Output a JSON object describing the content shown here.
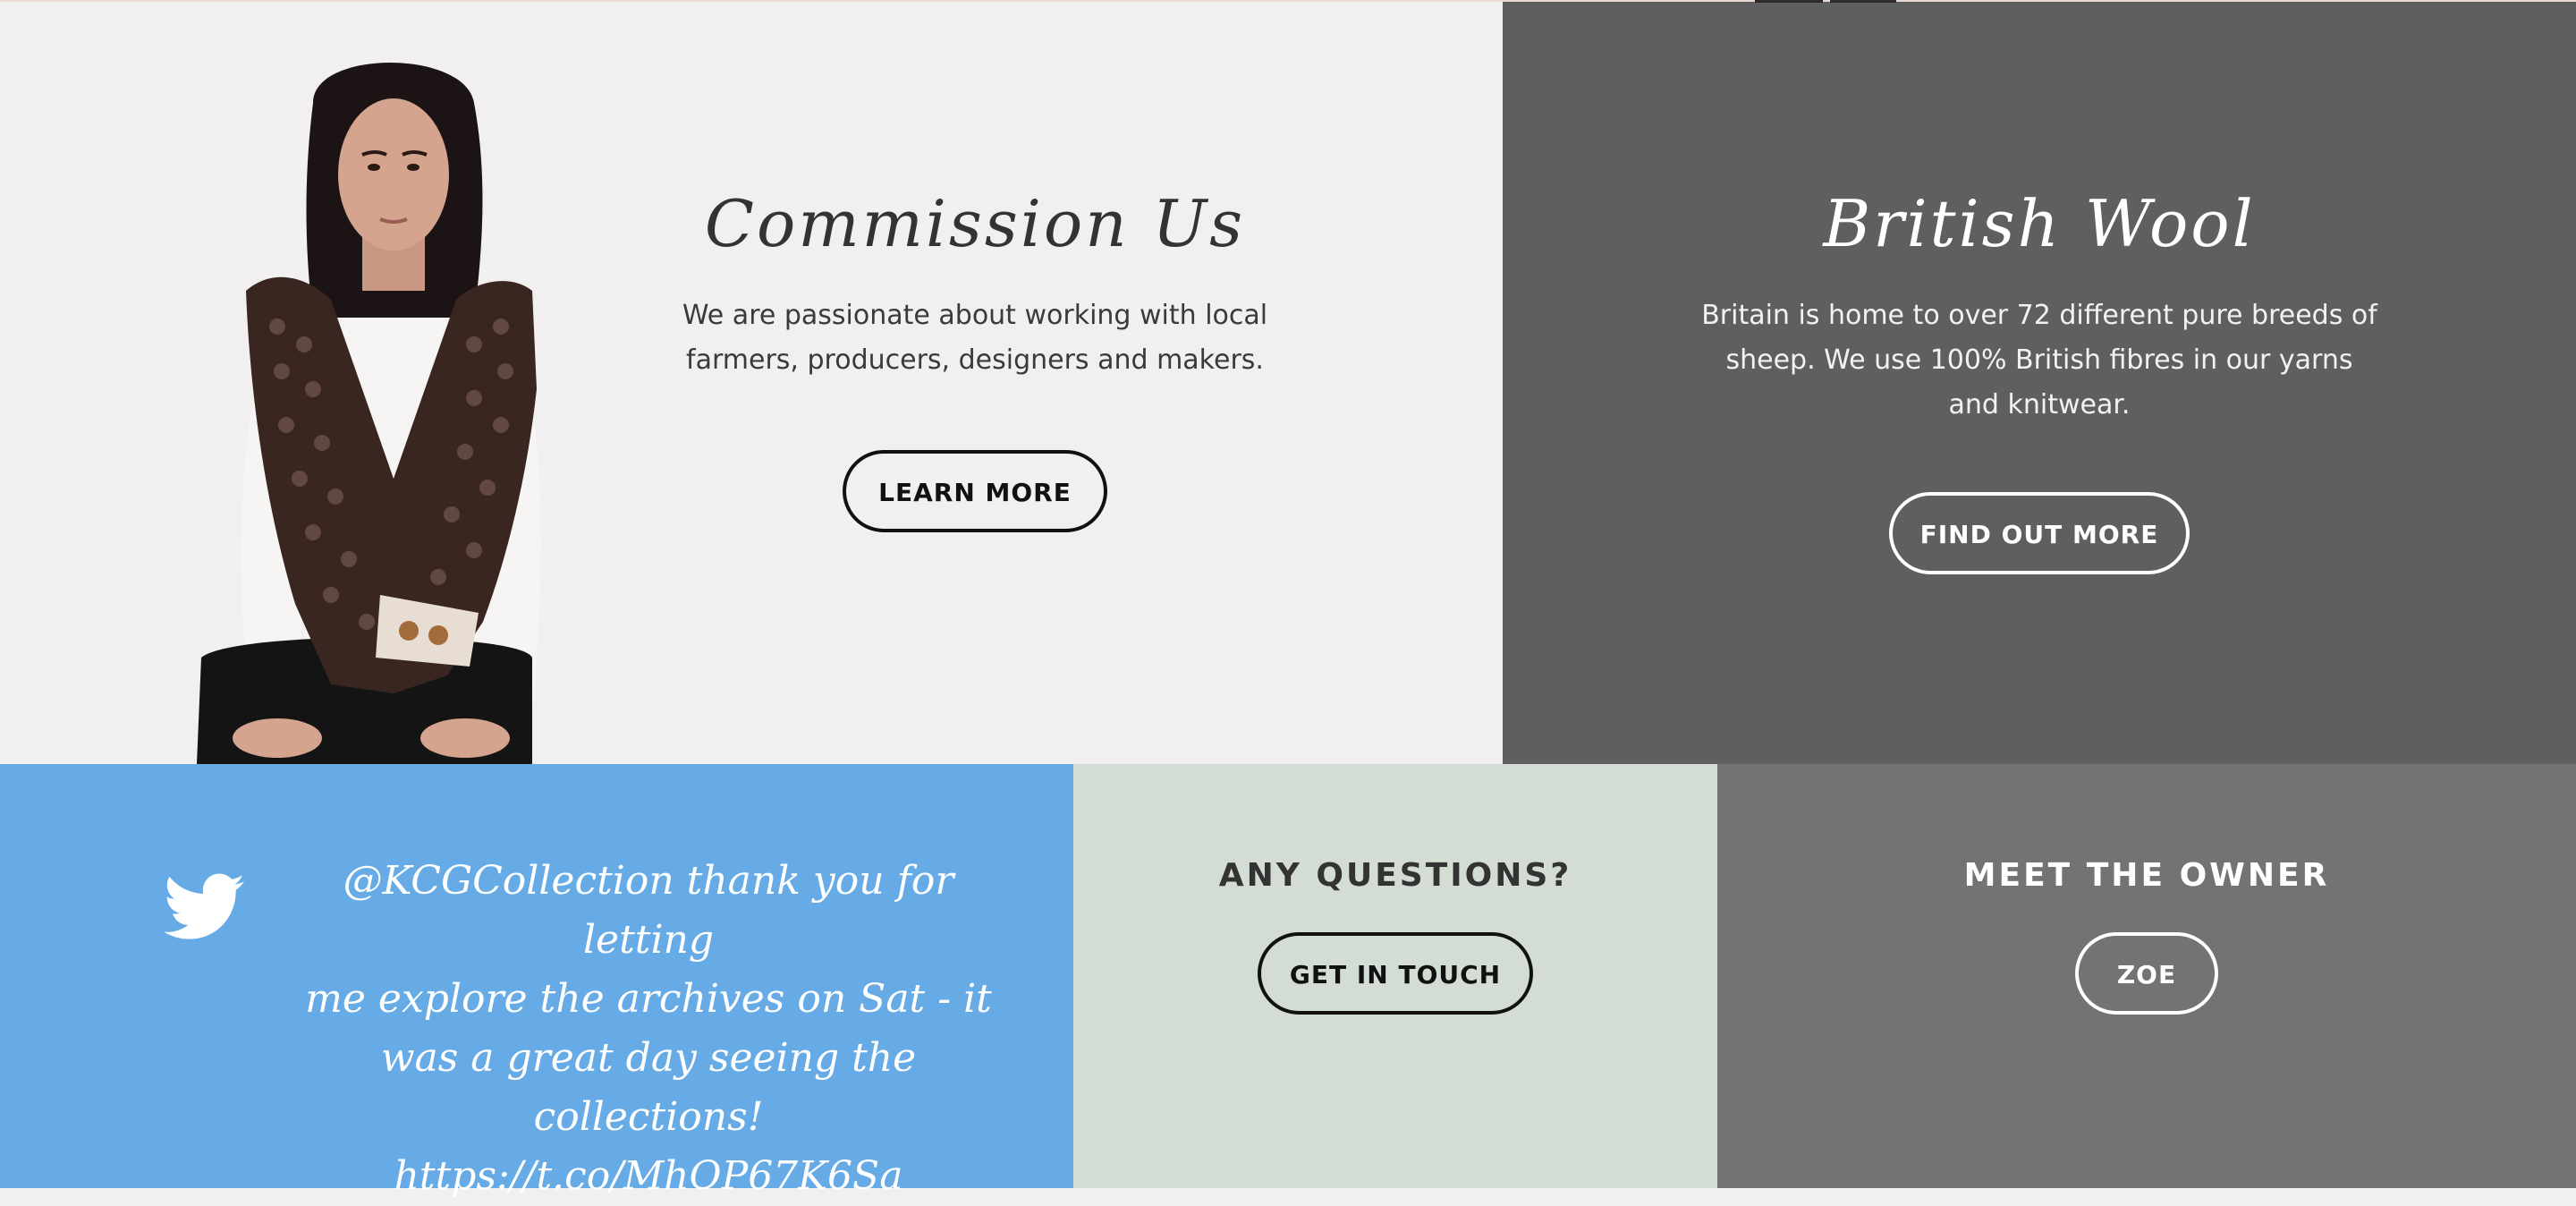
{
  "commission": {
    "title": "Commission Us",
    "body": "We are passionate about working with local farmers, producers, designers and makers.",
    "button_label": "LEARN MORE"
  },
  "wool": {
    "title": "British Wool",
    "body": "Britain is home to over 72 different pure breeds of sheep. We use 100% British fibres in our yarns and knitwear.",
    "button_label": "FIND OUT MORE"
  },
  "twitter": {
    "icon": "twitter-bird-icon",
    "tweet_line1": "@KCGCollection thank you for letting",
    "tweet_line2": "me explore the archives on Sat - it",
    "tweet_line3": "was a great day seeing the collections!",
    "tweet_line4": "https://t.co/MhOP67K6Sa"
  },
  "questions": {
    "heading": "ANY QUESTIONS?",
    "button_label": "GET IN TOUCH"
  },
  "owner": {
    "heading": "MEET THE OWNER",
    "button_label": "ZOE"
  },
  "colors": {
    "commission_bg": "#f2eff0",
    "wool_bg": "#5f5f5f",
    "twitter_bg": "#66aae6",
    "questions_bg": "#d3ddd4",
    "owner_bg": "#737373"
  }
}
